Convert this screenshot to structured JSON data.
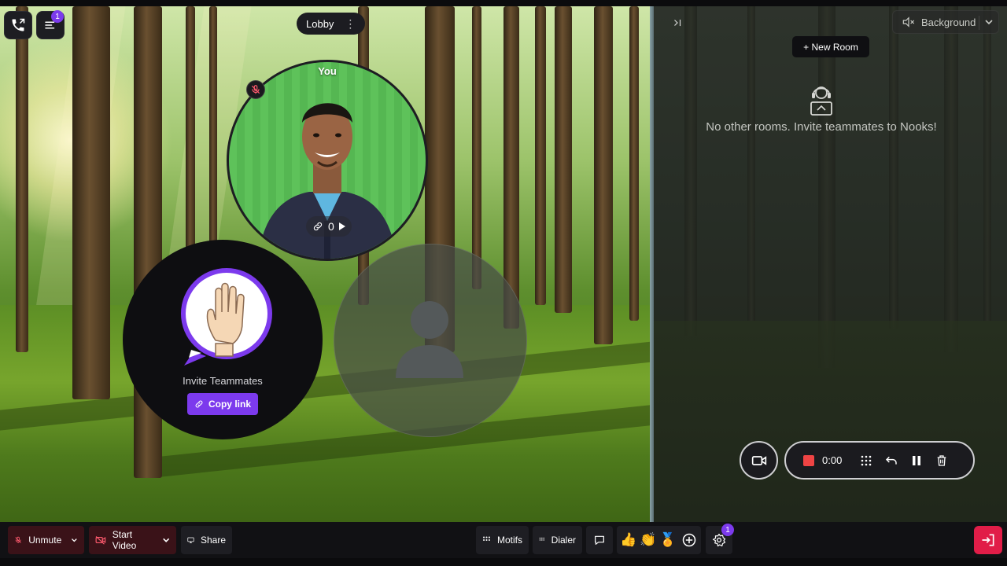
{
  "topbar": {
    "menu_badge": "1",
    "room_name": "Lobby",
    "room_menu": "⋮"
  },
  "stage": {
    "you_label": "You",
    "link_count": "0",
    "invite_label": "Invite Teammates",
    "copy_link_label": "Copy link"
  },
  "panel": {
    "background_label": "Background",
    "new_room_label": "+ New Room",
    "empty_message": "No other rooms. Invite teammates to Nooks!"
  },
  "recorder": {
    "time": "0:00"
  },
  "toolbar": {
    "unmute_label": "Unmute",
    "start_video_label": "Start Video",
    "share_label": "Share",
    "motifs_label": "Motifs",
    "dialer_label": "Dialer",
    "settings_badge": "1",
    "reactions": [
      "👍",
      "👏",
      "🏅"
    ]
  },
  "colors": {
    "accent": "#7c3aed",
    "record": "#ef4444",
    "exit": "#e11d48",
    "mute_bg": "#3a1218"
  }
}
